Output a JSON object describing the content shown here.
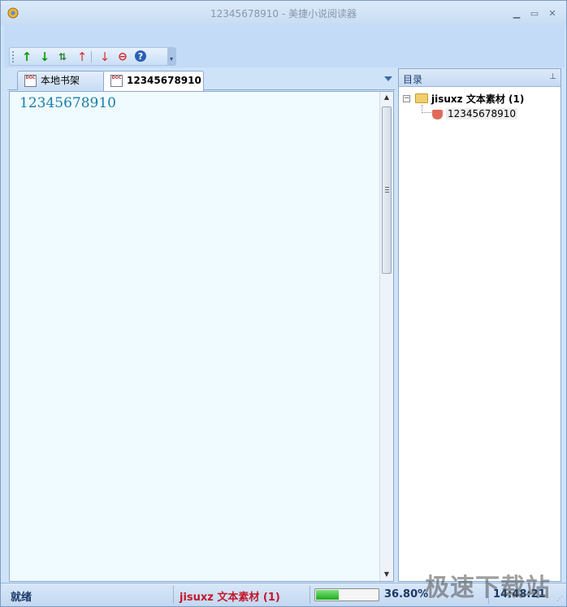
{
  "window": {
    "title": "12345678910 - 美捷小说阅读器",
    "controls": [
      "minimize",
      "maximize",
      "close"
    ]
  },
  "toolbar": {
    "buttons": [
      {
        "name": "move-up-icon",
        "glyph": "↑",
        "color": "#129b12"
      },
      {
        "name": "move-down-icon",
        "glyph": "↓",
        "color": "#129b12"
      },
      {
        "name": "sort-icon",
        "glyph": "⇅",
        "color": "#2f7d2f"
      },
      {
        "name": "prev-icon",
        "glyph": "↑",
        "color": "#d43030"
      },
      {
        "name": "next-icon",
        "glyph": "↓",
        "color": "#d43030"
      },
      {
        "name": "stop-icon",
        "glyph": "⊖",
        "color": "#d42020"
      },
      {
        "name": "help-icon",
        "glyph": "?",
        "color": "#2c5fb5"
      }
    ]
  },
  "tabs": [
    {
      "label": "本地书架",
      "active": false
    },
    {
      "label": "12345678910",
      "active": true
    }
  ],
  "document": {
    "content": "12345678910"
  },
  "toc": {
    "title": "目录",
    "root_label": "jisuxz 文本素材 (1)",
    "leaf_label": "12345678910"
  },
  "status": {
    "ready": "就绪",
    "book": "jisuxz 文本素材 (1)",
    "progress_percent": 36.8,
    "percent_text": "36.80%",
    "time": "14:48:21"
  },
  "watermark": "极速下载站",
  "colors": {
    "accent": "#1a7ea8",
    "status_book": "#c4162a",
    "progress": "#1fae1f"
  }
}
